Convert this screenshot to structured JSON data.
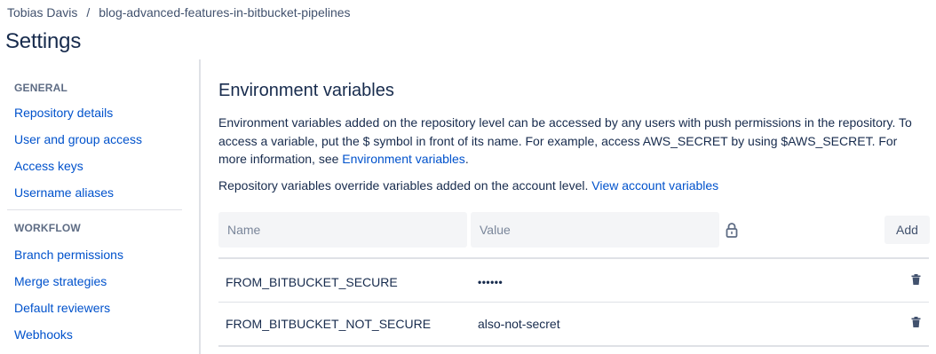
{
  "breadcrumb": {
    "owner": "Tobias Davis",
    "separator": "/",
    "repo": "blog-advanced-features-in-bitbucket-pipelines"
  },
  "page_title": "Settings",
  "sidebar": {
    "sections": [
      {
        "heading": "GENERAL",
        "items": [
          {
            "label": "Repository details"
          },
          {
            "label": "User and group access"
          },
          {
            "label": "Access keys"
          },
          {
            "label": "Username aliases"
          }
        ]
      },
      {
        "heading": "WORKFLOW",
        "items": [
          {
            "label": "Branch permissions"
          },
          {
            "label": "Merge strategies"
          },
          {
            "label": "Default reviewers"
          },
          {
            "label": "Webhooks"
          }
        ]
      }
    ]
  },
  "main": {
    "title": "Environment variables",
    "description": {
      "text": "Environment variables added on the repository level can be accessed by any users with push permissions in the repository. To access a variable, put the $ symbol in front of its name. For example, access AWS_SECRET by using $AWS_SECRET. For more information, see ",
      "link": "Environment variables",
      "suffix": "."
    },
    "override": {
      "text": "Repository variables override variables added on the account level. ",
      "link": "View account variables"
    },
    "form": {
      "name_placeholder": "Name",
      "value_placeholder": "Value",
      "add_label": "Add"
    },
    "variables": [
      {
        "name": "FROM_BITBUCKET_SECURE",
        "value": "••••••",
        "secured": true
      },
      {
        "name": "FROM_BITBUCKET_NOT_SECURE",
        "value": "also-not-secret",
        "secured": false
      }
    ]
  },
  "colors": {
    "link": "#0052cc",
    "text": "#172b4d",
    "muted": "#5e6c84",
    "input_bg": "#f4f5f7",
    "divider": "#dfe1e6"
  },
  "icons": {
    "lock": "lock-icon",
    "delete": "trash-icon"
  }
}
